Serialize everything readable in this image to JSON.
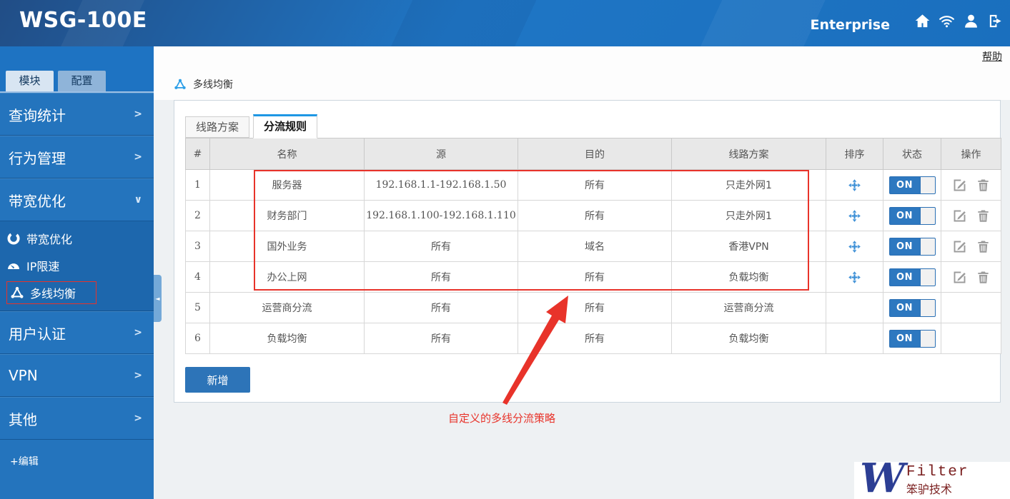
{
  "header": {
    "title": "WSG-100E",
    "edition": "Enterprise",
    "icons": [
      "home-icon",
      "wifi-icon",
      "user-icon",
      "logout-icon"
    ]
  },
  "help_link": "帮助",
  "sidebar": {
    "tabs": [
      {
        "label": "模块",
        "active": true
      },
      {
        "label": "配置",
        "active": false
      }
    ],
    "menu": [
      {
        "label": "查询统计",
        "arrow": ">"
      },
      {
        "label": "行为管理",
        "arrow": ">"
      },
      {
        "label": "带宽优化",
        "arrow": "∨"
      }
    ],
    "submenu": [
      {
        "label": "带宽优化",
        "icon": "ring-icon"
      },
      {
        "label": "IP限速",
        "icon": "gauge-icon"
      },
      {
        "label": "多线均衡",
        "icon": "triangle-network-icon",
        "highlighted": true
      }
    ],
    "menu_lower": [
      {
        "label": "用户认证",
        "arrow": ">"
      },
      {
        "label": "VPN",
        "arrow": ">"
      },
      {
        "label": "其他",
        "arrow": ">"
      }
    ],
    "edit_label": "+编辑",
    "collapse_glyph": "◄"
  },
  "breadcrumb": {
    "title": "多线均衡",
    "icon": "triangle-network-icon"
  },
  "content_tabs": [
    {
      "label": "线路方案",
      "active": false
    },
    {
      "label": "分流规则",
      "active": true
    }
  ],
  "table": {
    "headers": [
      "#",
      "名称",
      "源",
      "目的",
      "线路方案",
      "排序",
      "状态",
      "操作"
    ],
    "rows": [
      {
        "num": "1",
        "name": "服务器",
        "source": "192.168.1.1-192.168.1.50",
        "dest": "所有",
        "plan": "只走外网1",
        "status": "ON"
      },
      {
        "num": "2",
        "name": "财务部门",
        "source": "192.168.1.100-192.168.1.110",
        "dest": "所有",
        "plan": "只走外网1",
        "status": "ON"
      },
      {
        "num": "3",
        "name": "国外业务",
        "source": "所有",
        "dest": "域名",
        "plan": "香港VPN",
        "status": "ON"
      },
      {
        "num": "4",
        "name": "办公上网",
        "source": "所有",
        "dest": "所有",
        "plan": "负载均衡",
        "status": "ON"
      },
      {
        "num": "5",
        "name": "运营商分流",
        "source": "所有",
        "dest": "所有",
        "plan": "运营商分流",
        "status": "ON"
      },
      {
        "num": "6",
        "name": "负载均衡",
        "source": "所有",
        "dest": "所有",
        "plan": "负载均衡",
        "status": "ON"
      }
    ]
  },
  "add_button": "新增",
  "annotation": {
    "text": "自定义的多线分流策略"
  },
  "watermark": {
    "logo": "W",
    "brand": "Filter",
    "company": "笨驴技术"
  },
  "colors": {
    "header_blue": "#1e73c2",
    "sidebar_blue": "#2474bd",
    "submenu_blue": "#1d67ad",
    "accent_tab_bar": "#1e97e4",
    "toggle_blue": "#2d78c0",
    "annotation_red": "#e8332a",
    "watermark_blue": "#2c3e94",
    "watermark_red": "#7a1f1f"
  }
}
